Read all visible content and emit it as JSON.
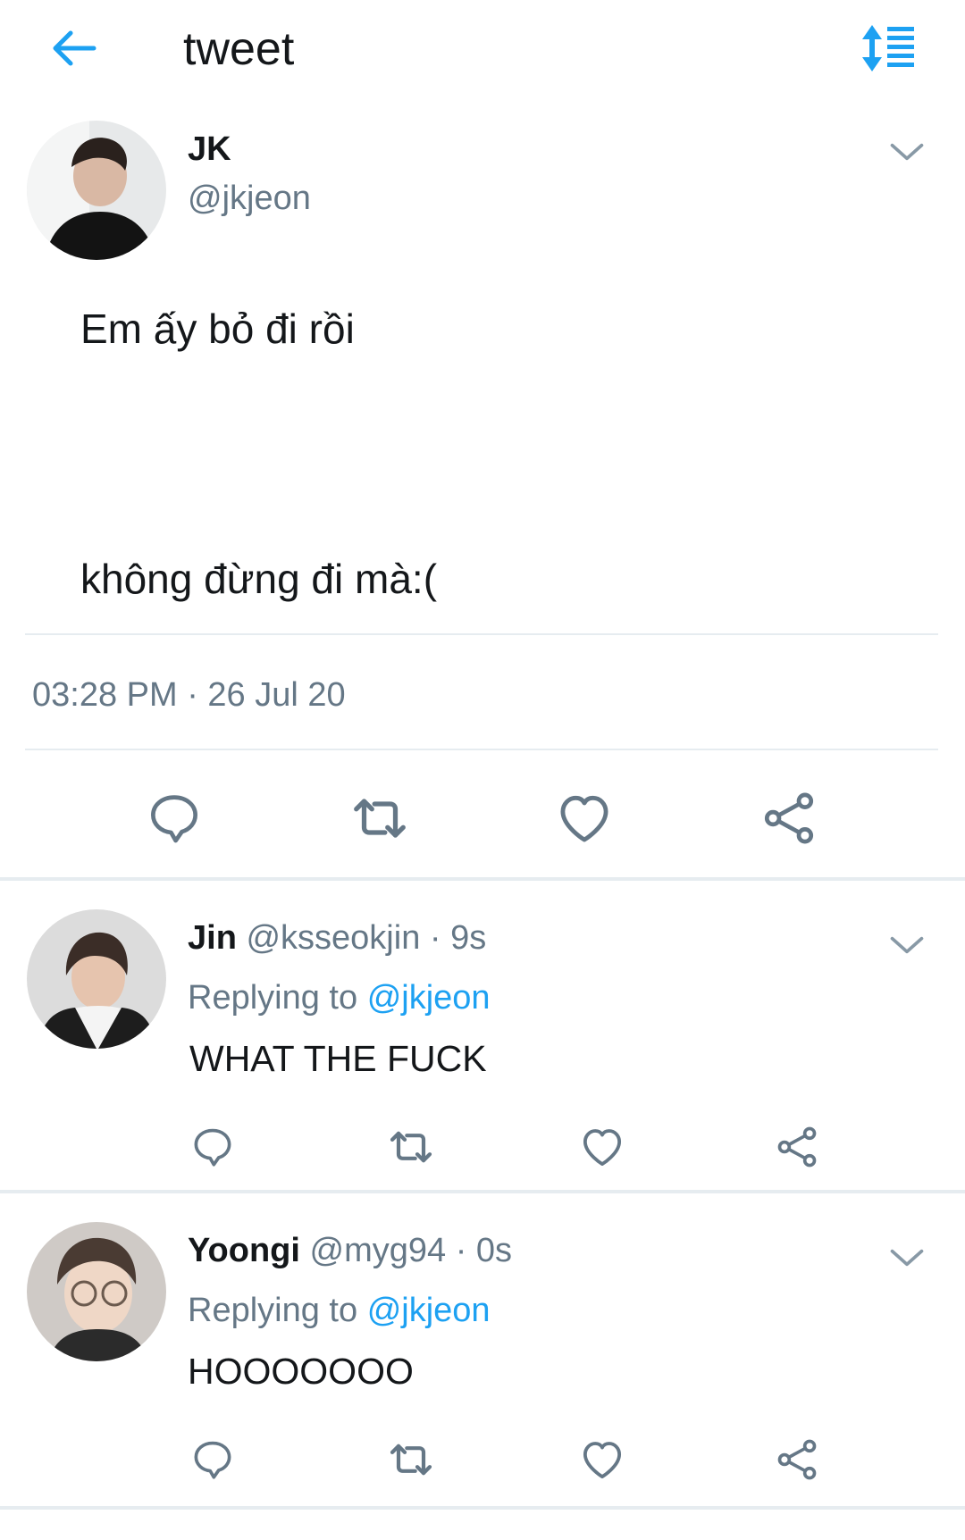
{
  "header": {
    "title": "tweet",
    "back_icon": "arrow-left-icon",
    "sort_icon": "sort-list-icon",
    "accent_color": "#1da1f2"
  },
  "main_tweet": {
    "author_name": "JK",
    "author_handle": "@jkjeon",
    "text_line_1": "Em ấy bỏ đi rồi",
    "text_line_2": "không đừng đi mà:(",
    "timestamp": "03:28 PM · 26 Jul 20",
    "actions": [
      "reply-icon",
      "retweet-icon",
      "like-icon",
      "share-icon"
    ]
  },
  "replies": [
    {
      "name": "Jin",
      "handle": "@ksseokjin",
      "time": "· 9s",
      "replying_prefix": "Replying to",
      "replying_to": "@jkjeon",
      "text": "WHAT THE FUCK"
    },
    {
      "name": "Yoongi",
      "handle": "@myg94",
      "time": "· 0s",
      "replying_prefix": "Replying to",
      "replying_to": "@jkjeon",
      "text": "HOOOOOOO"
    }
  ],
  "colors": {
    "text_primary": "#14171a",
    "text_secondary": "#657786",
    "icon_gray": "#657786",
    "divider": "#e6ecf0"
  }
}
